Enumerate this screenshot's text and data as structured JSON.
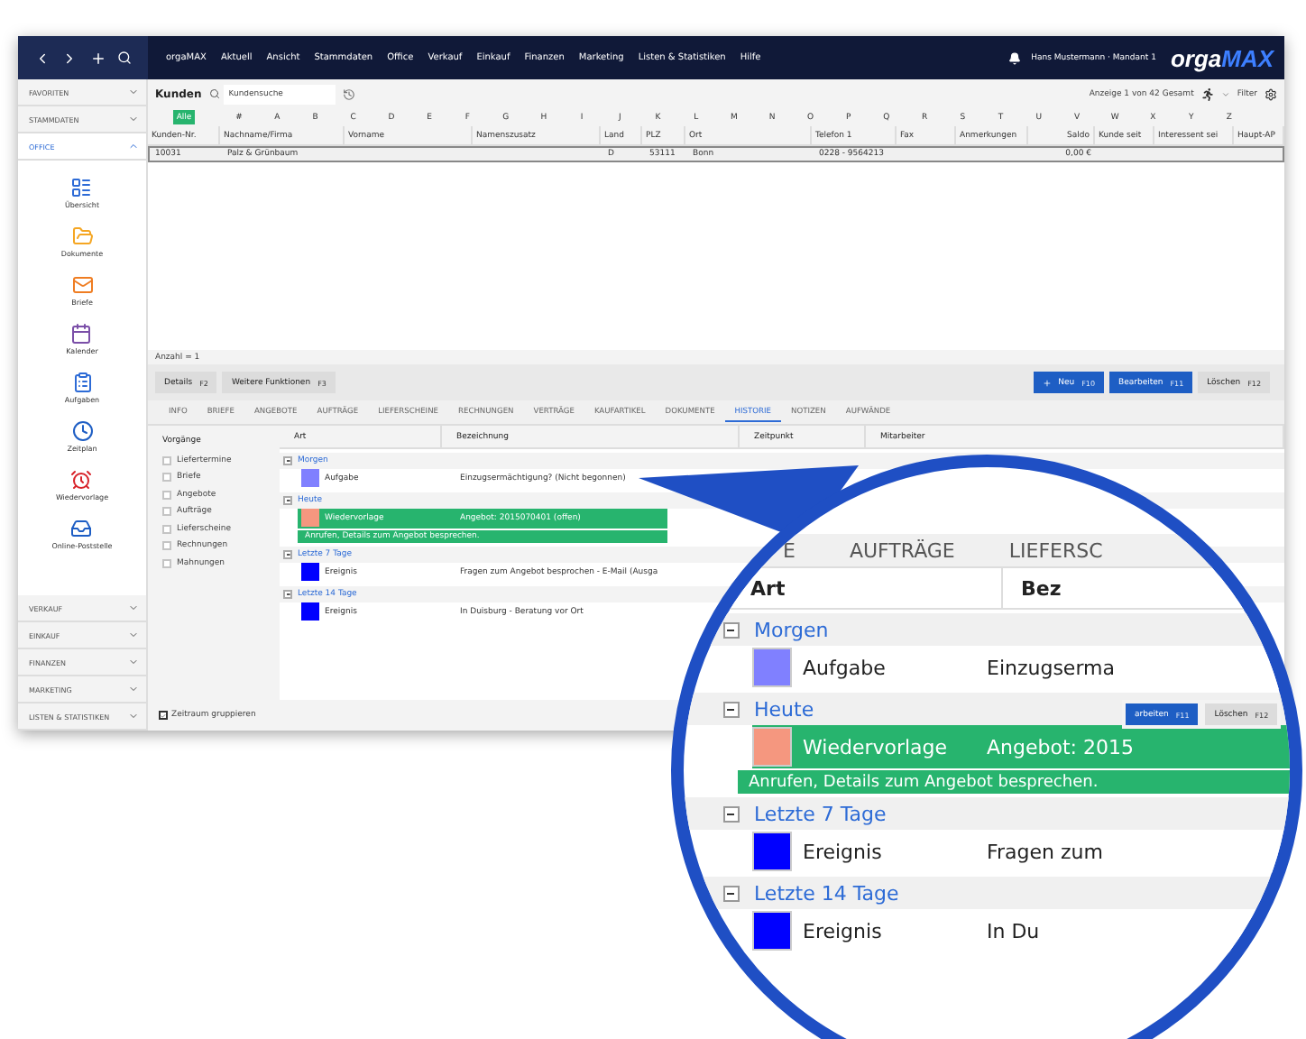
{
  "topbar": {
    "menu": [
      "orgaMAX",
      "Aktuell",
      "Ansicht",
      "Stammdaten",
      "Office",
      "Verkauf",
      "Einkauf",
      "Finanzen",
      "Marketing",
      "Listen & Statistiken",
      "Hilfe"
    ],
    "user": "Hans Mustermann · Mandant 1",
    "logo": {
      "first": "orga",
      "second": "MAX"
    }
  },
  "sidebar": {
    "sections": [
      {
        "label": "FAVORITEN",
        "expanded": false
      },
      {
        "label": "STAMMDATEN",
        "expanded": false
      },
      {
        "label": "OFFICE",
        "expanded": true,
        "items": [
          {
            "label": "Übersicht"
          },
          {
            "label": "Dokumente"
          },
          {
            "label": "Briefe"
          },
          {
            "label": "Kalender"
          },
          {
            "label": "Aufgaben"
          },
          {
            "label": "Zeitplan"
          },
          {
            "label": "Wiedervorlage"
          },
          {
            "label": "Online-Poststelle"
          }
        ]
      },
      {
        "label": "VERKAUF",
        "expanded": false
      },
      {
        "label": "EINKAUF",
        "expanded": false
      },
      {
        "label": "FINANZEN",
        "expanded": false
      },
      {
        "label": "MARKETING",
        "expanded": false
      },
      {
        "label": "LISTEN & STATISTIKEN",
        "expanded": false
      }
    ]
  },
  "toolbar": {
    "title": "Kunden",
    "search": {
      "placeholder": "Kundensuche"
    },
    "count": "Anzeige 1 von 42 Gesamt",
    "filter": "Filter"
  },
  "alphabet": [
    {
      "label": "Alle",
      "selected": true
    },
    {
      "label": "#",
      "selected": false
    },
    {
      "label": "A",
      "selected": false
    },
    {
      "label": "B",
      "selected": false
    },
    {
      "label": "C",
      "selected": false
    },
    {
      "label": "D",
      "selected": false
    },
    {
      "label": "E",
      "selected": false
    },
    {
      "label": "F",
      "selected": false
    },
    {
      "label": "G",
      "selected": false
    },
    {
      "label": "H",
      "selected": false
    },
    {
      "label": "I",
      "selected": false
    },
    {
      "label": "J",
      "selected": false
    },
    {
      "label": "K",
      "selected": false
    },
    {
      "label": "L",
      "selected": false
    },
    {
      "label": "M",
      "selected": false
    },
    {
      "label": "N",
      "selected": false
    },
    {
      "label": "O",
      "selected": false
    },
    {
      "label": "P",
      "selected": false
    },
    {
      "label": "Q",
      "selected": false
    },
    {
      "label": "R",
      "selected": false
    },
    {
      "label": "S",
      "selected": false
    },
    {
      "label": "T",
      "selected": false
    },
    {
      "label": "U",
      "selected": false
    },
    {
      "label": "V",
      "selected": false
    },
    {
      "label": "W",
      "selected": false
    },
    {
      "label": "X",
      "selected": false
    },
    {
      "label": "Y",
      "selected": false
    },
    {
      "label": "Z",
      "selected": false
    }
  ],
  "table": {
    "columns": [
      "Kunden-Nr.",
      "Nachname/Firma",
      "Vorname",
      "Namenszusatz",
      "Land",
      "PLZ",
      "Ort",
      "Telefon 1",
      "Fax",
      "Anmerkungen",
      "Saldo",
      "Kunde seit",
      "Interessent sei",
      "Haupt-AP"
    ],
    "rows": [
      {
        "selected": true,
        "cells": [
          "10031",
          "Palz & Grünbaum",
          null,
          null,
          "D",
          "53111",
          "Bonn",
          "0228 - 9564213",
          null,
          null,
          "0,00 €",
          null,
          null,
          null
        ]
      }
    ]
  },
  "count_label": "Anzahl = 1",
  "actions": {
    "left": [
      {
        "label": "Details",
        "key": "F2"
      },
      {
        "label": "Weitere Funktionen",
        "key": "F3"
      }
    ],
    "right": [
      {
        "label": "Neu",
        "key": "F10",
        "kind": "primary",
        "plus": true
      },
      {
        "label": "Bearbeiten",
        "key": "F11",
        "kind": "primary",
        "plus": false
      },
      {
        "label": "Löschen",
        "key": "F12",
        "kind": "secondary",
        "plus": false
      }
    ]
  },
  "tabs": [
    {
      "label": "INFO",
      "selected": false
    },
    {
      "label": "BRIEFE",
      "selected": false
    },
    {
      "label": "ANGEBOTE",
      "selected": false
    },
    {
      "label": "AUFTRÄGE",
      "selected": false
    },
    {
      "label": "LIEFERSCHEINE",
      "selected": false
    },
    {
      "label": "RECHNUNGEN",
      "selected": false
    },
    {
      "label": "VERTRÄGE",
      "selected": false
    },
    {
      "label": "KAUFARTIKEL",
      "selected": false
    },
    {
      "label": "DOKUMENTE",
      "selected": false
    },
    {
      "label": "HISTORIE",
      "selected": true
    },
    {
      "label": "NOTIZEN",
      "selected": false
    },
    {
      "label": "AUFWÄNDE",
      "selected": false
    }
  ],
  "history": {
    "filter_title": "Vorgänge",
    "filters": [
      {
        "label": "Liefertermine",
        "checked": false
      },
      {
        "label": "Briefe",
        "checked": false
      },
      {
        "label": "Angebote",
        "checked": false
      },
      {
        "label": "Aufträge",
        "checked": false
      },
      {
        "label": "Lieferscheine",
        "checked": false
      },
      {
        "label": "Rechnungen",
        "checked": false
      },
      {
        "label": "Mahnungen",
        "checked": false
      }
    ],
    "columns": [
      "Art",
      "Bezeichnung",
      "Zeitpunkt",
      "Mitarbeiter"
    ],
    "groups": [
      {
        "label": "Morgen",
        "entries": [
          {
            "type": "Aufgabe",
            "color": "#8080ff",
            "text": "Einzugsermächtigung? (Nicht begonnen)",
            "highlighted": false
          }
        ]
      },
      {
        "label": "Heute",
        "entries": [
          {
            "type": "Wiedervorlage",
            "color": "#f5977f",
            "text": "Angebot: 2015070401 (offen)",
            "note": "Anrufen, Details zum Angebot besprechen.",
            "highlighted": true
          }
        ]
      },
      {
        "label": "Letzte 7 Tage",
        "entries": [
          {
            "type": "Ereignis",
            "color": "#0000ff",
            "text": "Fragen zum Angebot besprochen - E-Mail (Ausga",
            "highlighted": false
          }
        ]
      },
      {
        "label": "Letzte 14 Tage",
        "entries": [
          {
            "type": "Ereignis",
            "color": "#0000ff",
            "text": "In Duisburg - Beratung vor Ort",
            "highlighted": false
          }
        ]
      }
    ],
    "group_toggle": {
      "label": "Zeitraum gruppieren",
      "checked": true
    }
  },
  "magnifier": {
    "tabs": [
      "E",
      "AUFTRÄGE",
      "LIEFERSC"
    ],
    "columns": [
      "Art",
      "Bez"
    ],
    "groups": [
      {
        "label": "Morgen",
        "entries": [
          {
            "type": "Aufgabe",
            "color": "#8080ff",
            "text": "Einzugserma",
            "highlighted": false
          }
        ]
      },
      {
        "label": "Heute",
        "entries": [
          {
            "type": "Wiedervorlage",
            "color": "#f5977f",
            "text": "Angebot: 2015",
            "note": "Anrufen, Details zum Angebot besprechen.",
            "highlighted": true
          }
        ]
      },
      {
        "label": "Letzte 7 Tage",
        "entries": [
          {
            "type": "Ereignis",
            "color": "#0000ff",
            "text": "Fragen zum",
            "highlighted": false
          }
        ]
      },
      {
        "label": "Letzte 14 Tage",
        "entries": [
          {
            "type": "Ereignis",
            "color": "#0000ff",
            "text": "In Du",
            "highlighted": false
          }
        ]
      }
    ],
    "buttons": [
      {
        "label": "arbeiten",
        "key": "F11",
        "kind": "primary"
      },
      {
        "label": "Löschen",
        "key": "F12",
        "kind": "secondary"
      }
    ]
  }
}
